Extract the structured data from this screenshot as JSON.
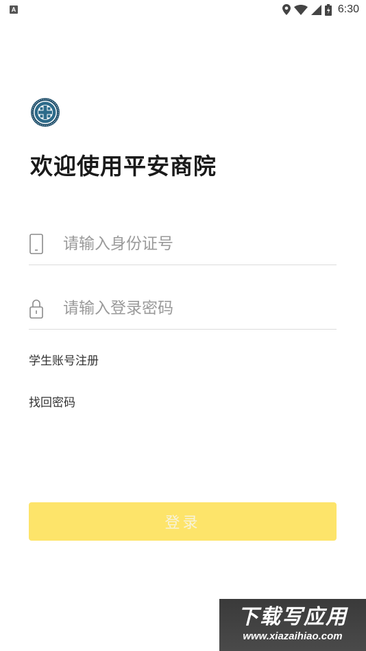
{
  "status_bar": {
    "notification_badge": "A",
    "icons": [
      "location-icon",
      "wifi-icon",
      "signal-icon",
      "battery-icon"
    ],
    "time": "6:30"
  },
  "app": {
    "welcome_title": "欢迎使用平安商院"
  },
  "form": {
    "id_placeholder": "请输入身份证号",
    "password_placeholder": "请输入登录密码",
    "id_value": "",
    "password_value": ""
  },
  "links": {
    "register": "学生账号注册",
    "recover_password": "找回密码"
  },
  "login_button": {
    "label": "登录",
    "color": "#fde46a"
  },
  "watermark": {
    "title": "下载写应用",
    "url": "www.xiazaihiao.com"
  }
}
